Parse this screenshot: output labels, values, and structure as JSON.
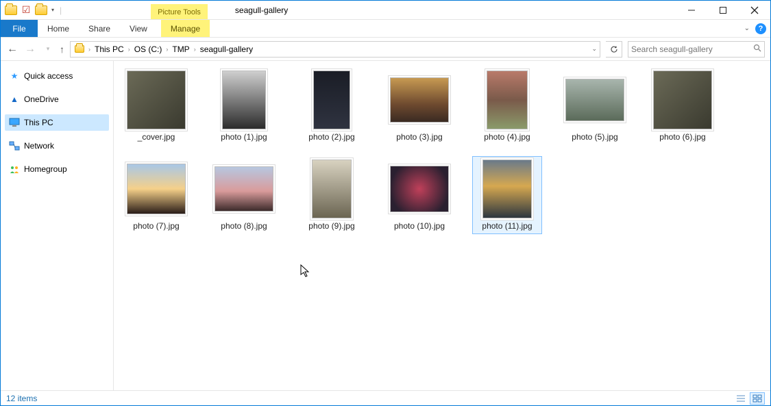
{
  "window": {
    "contextual_tab_label": "Picture Tools",
    "title": "seagull-gallery"
  },
  "ribbon": {
    "file": "File",
    "tabs": [
      "Home",
      "Share",
      "View"
    ],
    "context_tab": "Manage"
  },
  "breadcrumbs": [
    "This PC",
    "OS (C:)",
    "TMP",
    "seagull-gallery"
  ],
  "search": {
    "placeholder": "Search seagull-gallery"
  },
  "sidebar": {
    "items": [
      {
        "id": "quick-access",
        "label": "Quick access",
        "icon": "star"
      },
      {
        "id": "onedrive",
        "label": "OneDrive",
        "icon": "cloud"
      },
      {
        "id": "this-pc",
        "label": "This PC",
        "icon": "monitor"
      },
      {
        "id": "network",
        "label": "Network",
        "icon": "net"
      },
      {
        "id": "homegroup",
        "label": "Homegroup",
        "icon": "home"
      }
    ],
    "selected": "this-pc"
  },
  "files": [
    {
      "name": "_cover.jpg",
      "w": 86,
      "h": 86,
      "bg": "linear-gradient(135deg,#6b6a57,#3a3a2f)"
    },
    {
      "name": "photo (1).jpg",
      "w": 64,
      "h": 86,
      "bg": "linear-gradient(#cfcfcf,#2b2b2b)"
    },
    {
      "name": "photo (2).jpg",
      "w": 54,
      "h": 86,
      "bg": "linear-gradient(#1a1d26,#2f3340)"
    },
    {
      "name": "photo (3).jpg",
      "w": 86,
      "h": 66,
      "bg": "linear-gradient(#c79a52,#6e4a2f 60%,#3a2a22)"
    },
    {
      "name": "photo (4).jpg",
      "w": 60,
      "h": 86,
      "bg": "linear-gradient(#b97a6a,#7a5a4a 50%,#8a9a6a)"
    },
    {
      "name": "photo (5).jpg",
      "w": 86,
      "h": 62,
      "bg": "linear-gradient(#a8b5ad,#5b6b5a)"
    },
    {
      "name": "photo (6).jpg",
      "w": 86,
      "h": 86,
      "bg": "linear-gradient(135deg,#6b6a57,#3a3a2f)"
    },
    {
      "name": "photo (7).jpg",
      "w": 86,
      "h": 74,
      "bg": "linear-gradient(#a9c7e6 0%,#f5d089 50%,#2a1d18 100%)"
    },
    {
      "name": "photo (8).jpg",
      "w": 86,
      "h": 66,
      "bg": "linear-gradient(#b7c7e0 0%,#d99b9b 55%,#3c2b2b 100%)"
    },
    {
      "name": "photo (9).jpg",
      "w": 58,
      "h": 86,
      "bg": "linear-gradient(#d8d2c0,#6b6552)"
    },
    {
      "name": "photo (10).jpg",
      "w": 86,
      "h": 68,
      "bg": "radial-gradient(circle,#c0405a 0%,#2a2030 80%)"
    },
    {
      "name": "photo (11).jpg",
      "w": 72,
      "h": 86,
      "bg": "linear-gradient(#6a7a8a 0%,#d6a850 45%,#2c3640 100%)"
    }
  ],
  "selected_file_index": 11,
  "status": {
    "item_count": "12 items"
  }
}
